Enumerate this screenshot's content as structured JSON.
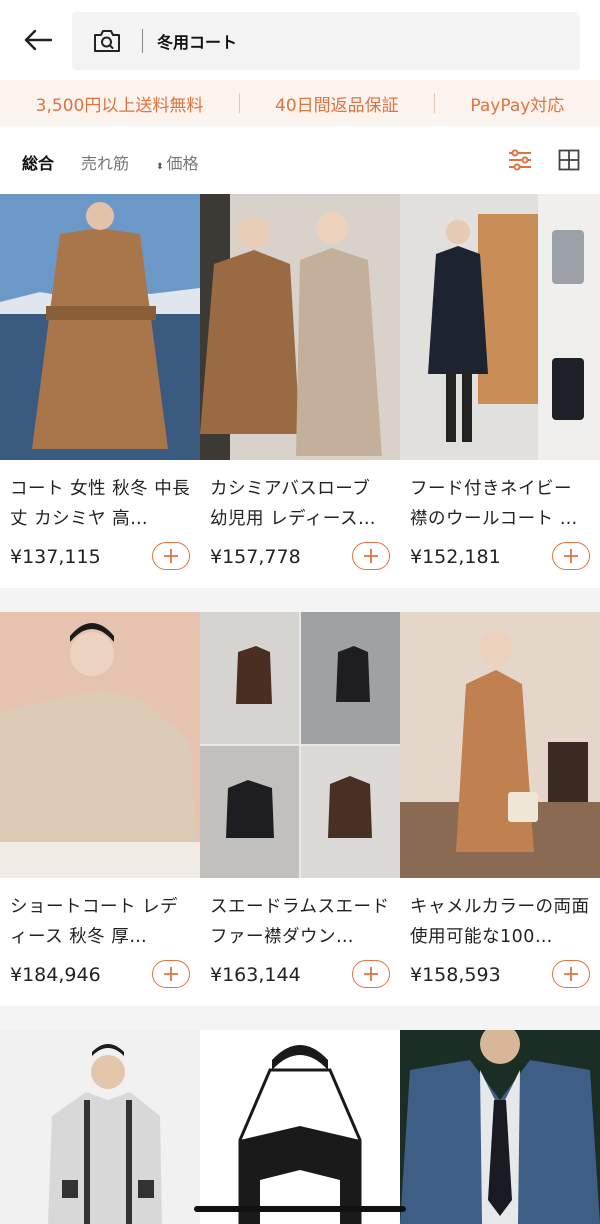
{
  "header": {
    "search_query": "冬用コート"
  },
  "benefits": [
    "3,500円以上送料無料",
    "40日間返品保証",
    "PayPay対応"
  ],
  "sortbar": {
    "default": "総合",
    "best_selling": "売れ筋",
    "price": "価格"
  },
  "products": [
    {
      "title": "コート 女性 秋冬 中長丈 カシミヤ 高…",
      "price": "¥137,115"
    },
    {
      "title": "カシミアバスローブ 幼児用 レディース…",
      "price": "¥157,778"
    },
    {
      "title": "フード付きネイビー 襟のウールコート …",
      "price": "¥152,181"
    },
    {
      "title": "ショートコート レディース 秋冬 厚…",
      "price": "¥184,946"
    },
    {
      "title": "スエードラムスエードファー襟ダウン…",
      "price": "¥163,144"
    },
    {
      "title": "キャメルカラーの両面使用可能な100…",
      "price": "¥158,593"
    }
  ],
  "colors": {
    "accent": "#e0733e",
    "benefit_bg": "#fbf3ee",
    "divider_bg": "#f4f4f4"
  }
}
